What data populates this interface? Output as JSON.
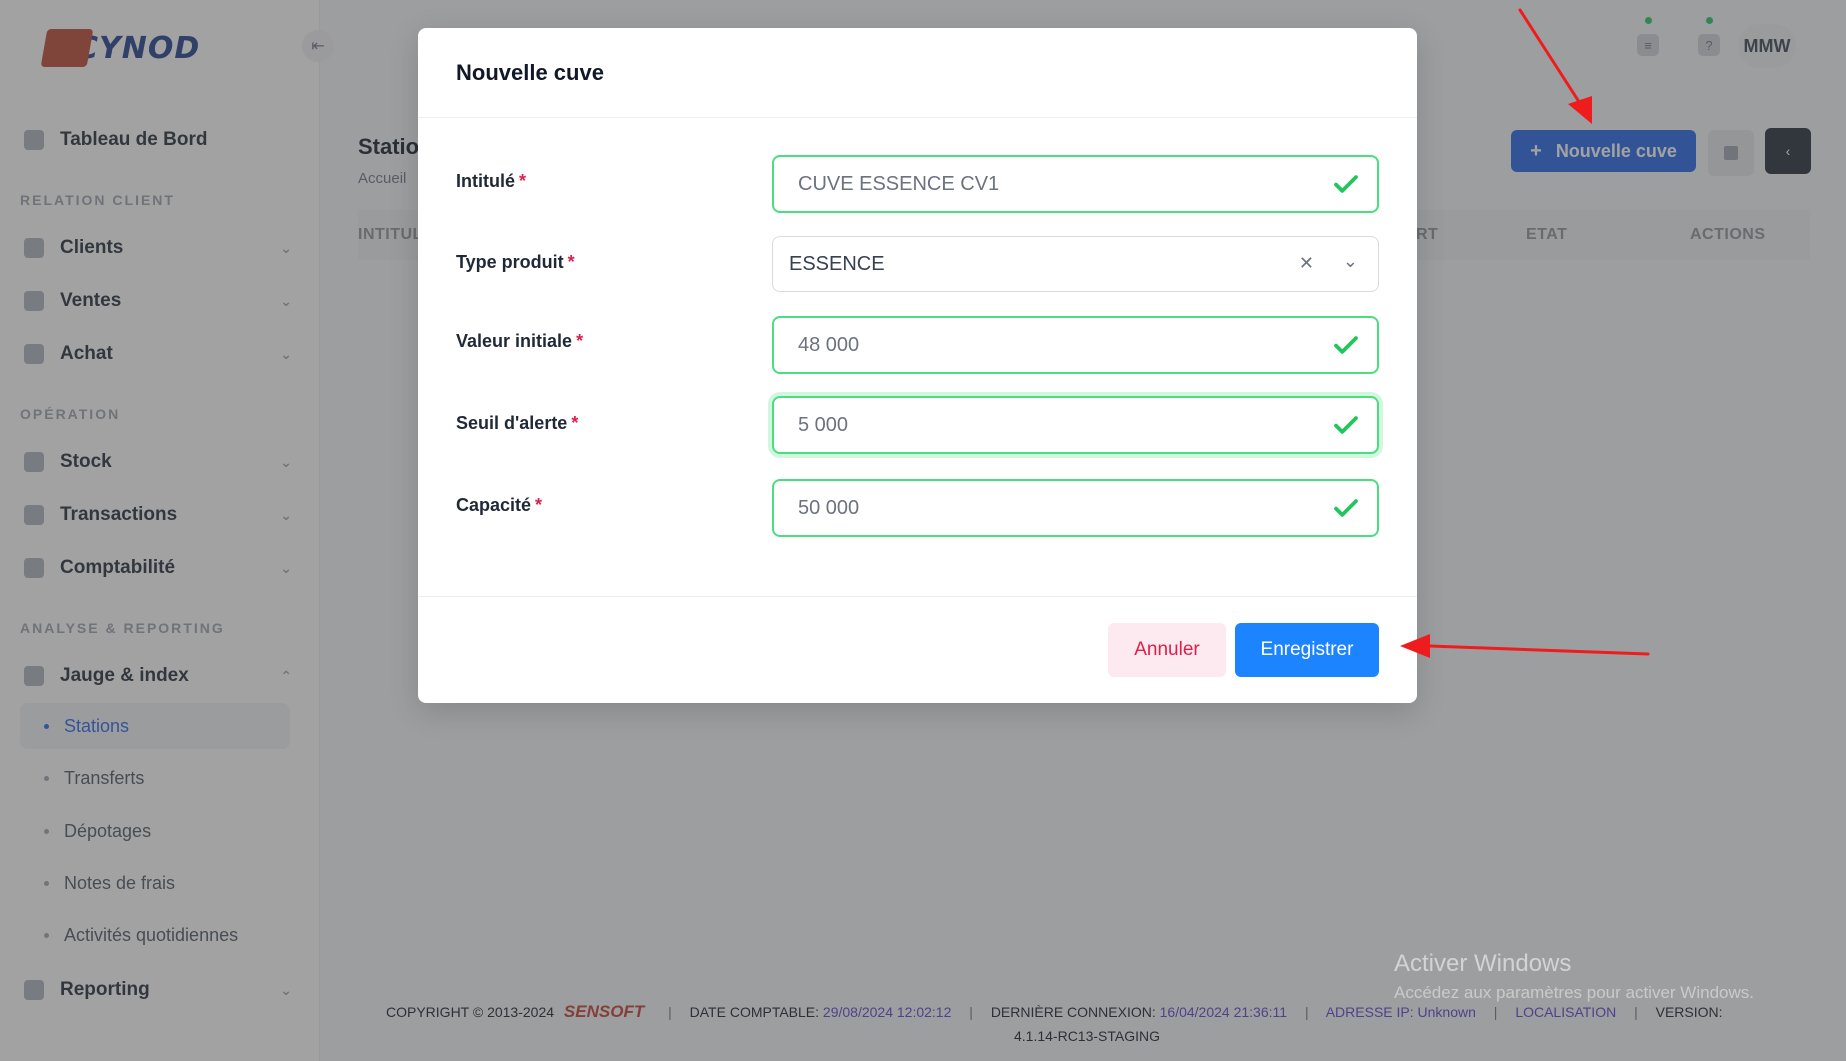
{
  "app": {
    "logo_text": "CYNOD"
  },
  "sidebar": {
    "dashboard": "Tableau de Bord",
    "sections": [
      "RELATION CLIENT",
      "OPÉRATION",
      "ANALYSE & REPORTING"
    ],
    "items": [
      {
        "label": "Clients"
      },
      {
        "label": "Ventes"
      },
      {
        "label": "Achat"
      },
      {
        "label": "Stock"
      },
      {
        "label": "Transactions"
      },
      {
        "label": "Comptabilité"
      },
      {
        "label": "Jauge & index"
      },
      {
        "label": "Reporting"
      }
    ],
    "sub_items": [
      {
        "label": "Stations",
        "active": true
      },
      {
        "label": "Transferts"
      },
      {
        "label": "Dépotages"
      },
      {
        "label": "Notes de frais"
      },
      {
        "label": "Activités quotidiennes"
      }
    ]
  },
  "header": {
    "user_initials": "MMW"
  },
  "page": {
    "title": "Statio",
    "breadcrumb": "Accueil",
    "new_button": "Nouvelle cuve",
    "columns": [
      "INTITUL",
      "RT",
      "ETAT",
      "ACTIONS"
    ]
  },
  "modal": {
    "title": "Nouvelle cuve",
    "required_mark": "*",
    "fields": {
      "intitule": {
        "label": "Intitulé",
        "value": "CUVE ESSENCE CV1"
      },
      "type_produit": {
        "label": "Type produit",
        "value": "ESSENCE"
      },
      "valeur_initiale": {
        "label": "Valeur initiale",
        "value": "48 000"
      },
      "seuil_alerte": {
        "label": "Seuil d'alerte",
        "value": "5 000"
      },
      "capacite": {
        "label": "Capacité",
        "value": "50 000"
      }
    },
    "cancel": "Annuler",
    "save": "Enregistrer"
  },
  "footer": {
    "copyright": "COPYRIGHT © 2013-2024",
    "brand": "SENSOFT",
    "date_label": "DATE COMPTABLE:",
    "date_value": "29/08/2024 12:02:12",
    "login_label": "DERNIÈRE CONNEXION:",
    "login_value": "16/04/2024 21:36:11",
    "ip_label": "ADRESSE IP:",
    "ip_value": "Unknown",
    "localisation": "LOCALISATION",
    "version_label": "VERSION:",
    "version_value": "4.1.14-RC13-STAGING"
  },
  "watermark": {
    "title": "Activer Windows",
    "subtitle": "Accédez aux paramètres pour activer Windows."
  },
  "colors": {
    "primary": "#1d84ff",
    "success": "#22c55e",
    "danger": "#e11d48",
    "annotation_arrow": "#ee1c1c"
  }
}
